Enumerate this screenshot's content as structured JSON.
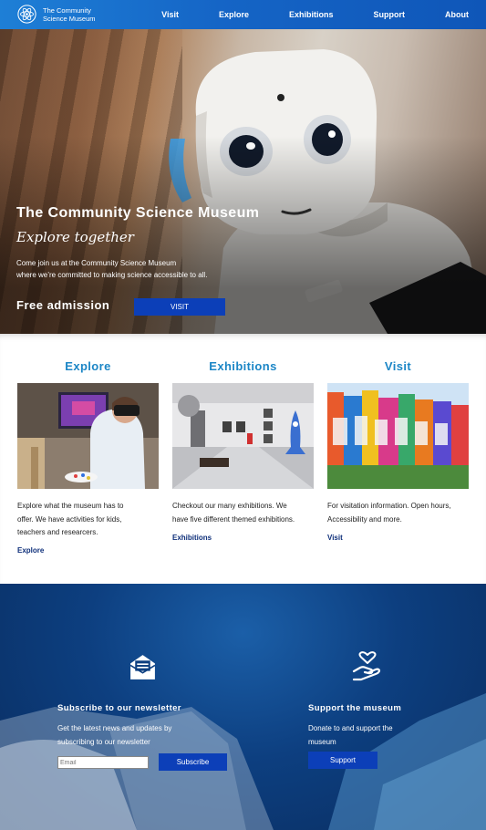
{
  "header": {
    "logo_line1": "The Community",
    "logo_line2": "Science Museum",
    "nav": [
      "Visit",
      "Explore",
      "Exhibitions",
      "Support",
      "About"
    ]
  },
  "hero": {
    "title": "The Community Science Museum",
    "subtitle": "Explore together",
    "desc_line1": "Come join us at the Community Science Museum",
    "desc_line2": "where we’re committed to making science accessible to all.",
    "free": "Free admission",
    "visit_button": "VISIT"
  },
  "cards": [
    {
      "heading": "Explore",
      "text": [
        "Explore what the museum has to",
        "offer. We have activities for kids,",
        "teachers and researcers."
      ],
      "link": "Explore"
    },
    {
      "heading": "Exhibitions",
      "text": [
        "Checkout our many exhibitions. We",
        "have five different themed exhibitions."
      ],
      "link": "Exhibitions"
    },
    {
      "heading": "Visit",
      "text": [
        "For visitation information. Open hours,",
        "Accessibility and more."
      ],
      "link": "Visit"
    }
  ],
  "footer": {
    "newsletter": {
      "heading": "Subscribe to our newsletter",
      "line1": "Get the latest news and updates by",
      "line2": "subscribing to our newsletter",
      "placeholder": "Email",
      "button": "Subscribe"
    },
    "support": {
      "heading": "Support the museum",
      "line1": "Donate to and support the",
      "line2": "museum",
      "button": "Support"
    }
  },
  "colors": {
    "header_blue": "#1565c6",
    "button_blue": "#0c3fb8",
    "heading_blue": "#1c86c6",
    "link_navy": "#0e2f7a"
  },
  "icons": [
    "atom-logo-icon",
    "envelope-icon",
    "hand-heart-icon"
  ]
}
